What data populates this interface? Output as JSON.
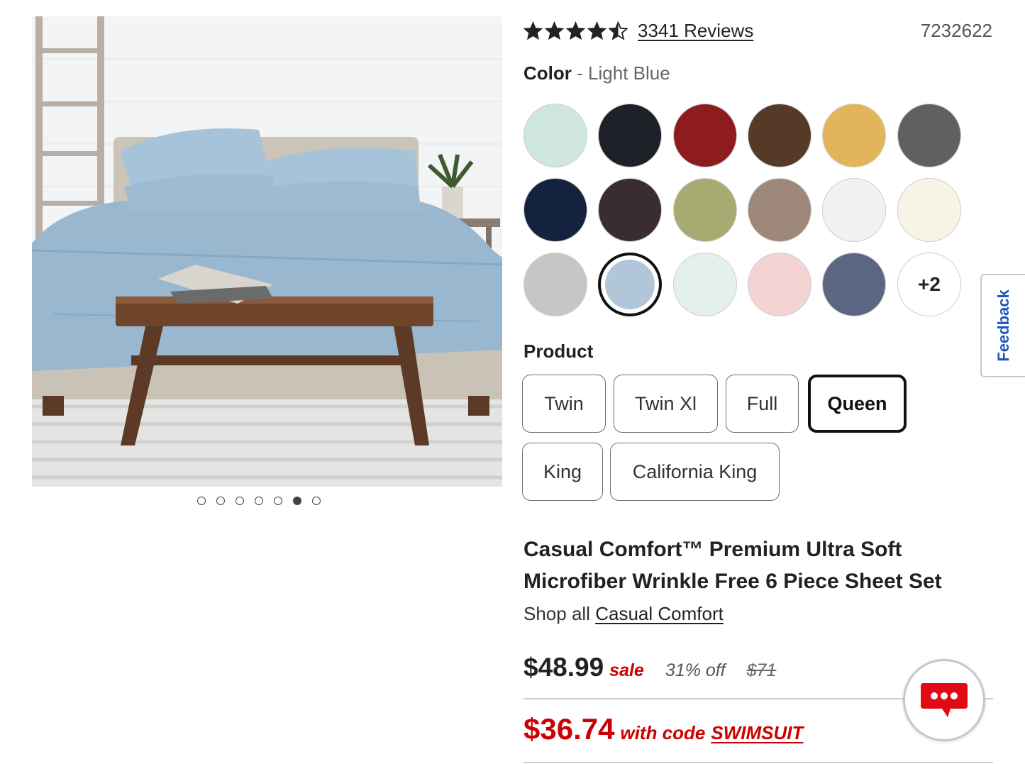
{
  "rating": {
    "stars": 4.5,
    "reviews_label": "3341 Reviews"
  },
  "sku": "7232622",
  "color": {
    "label": "Color",
    "separator": "-",
    "selected_name": "Light Blue",
    "swatches": [
      {
        "hex": "#cfe6e0"
      },
      {
        "hex": "#1f2128"
      },
      {
        "hex": "#8e1c1f"
      },
      {
        "hex": "#563a28"
      },
      {
        "hex": "#e2b55a"
      },
      {
        "hex": "#5f605f"
      },
      {
        "hex": "#13223e"
      },
      {
        "hex": "#3a2c33"
      },
      {
        "hex": "#a7ab72"
      },
      {
        "hex": "#9c8778"
      },
      {
        "hex": "#f1f1f1"
      },
      {
        "hex": "#f7f4e6"
      },
      {
        "hex": "#c6c6c6"
      },
      {
        "hex": "#b2c6da",
        "selected": true
      },
      {
        "hex": "#e4f0ea"
      },
      {
        "hex": "#f3d4d2"
      },
      {
        "hex": "#5b6782"
      }
    ],
    "more_label": "+2"
  },
  "product": {
    "label": "Product",
    "sizes": [
      {
        "label": "Twin"
      },
      {
        "label": "Twin Xl"
      },
      {
        "label": "Full"
      },
      {
        "label": "Queen",
        "selected": true
      },
      {
        "label": "King"
      },
      {
        "label": "California King"
      }
    ]
  },
  "title": "Casual Comfort™ Premium Ultra Soft Microfiber Wrinkle Free 6 Piece Sheet Set",
  "shop_all": {
    "prefix": "Shop all",
    "brand": "Casual Comfort"
  },
  "pricing": {
    "price": "$48.99",
    "sale_label": "sale",
    "discount": "31% off",
    "original": "$71",
    "code_price": "$36.74",
    "with_code_label": "with code",
    "code": "SWIMSUIT"
  },
  "carousel": {
    "total": 7,
    "active_index": 5
  },
  "feedback_label": "Feedback",
  "colors": {
    "accent_red": "#cc0000",
    "feedback_blue": "#1f56b8"
  }
}
